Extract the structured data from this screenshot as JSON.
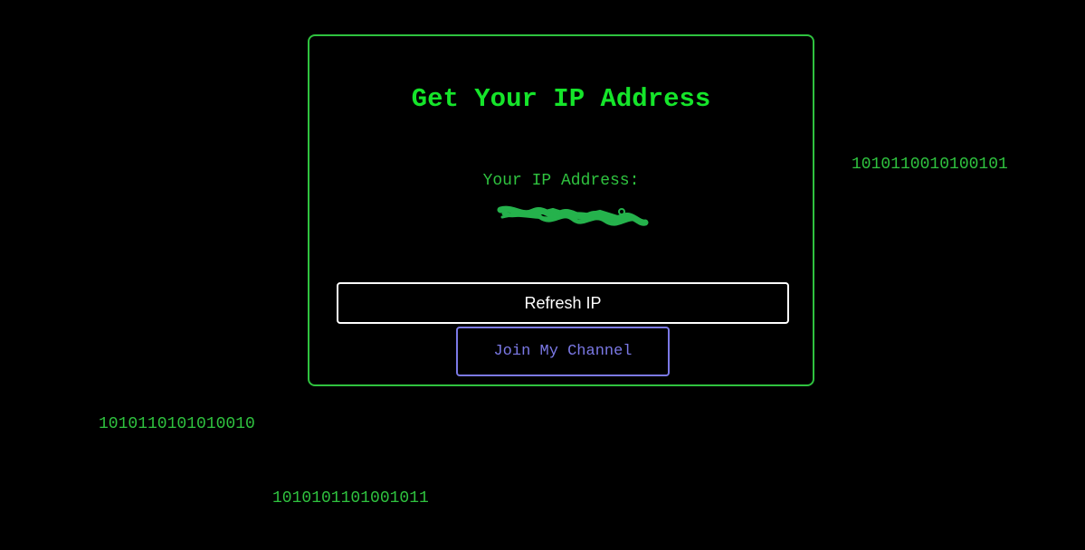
{
  "colors": {
    "background": "#000000",
    "accent_green": "#2fc23f",
    "title_green": "#15e52a",
    "redaction_green": "#25b24c",
    "refresh_border": "#ffffff",
    "channel_purple": "#7b79e6"
  },
  "background_binary": [
    "1010110010100101",
    "1010110101010010",
    "1010101101001011"
  ],
  "card": {
    "title": "Get Your IP Address",
    "ip_label": "Your IP Address:",
    "ip_value_redacted": true,
    "refresh_button_label": "Refresh IP",
    "channel_button_label": "Join My Channel"
  }
}
